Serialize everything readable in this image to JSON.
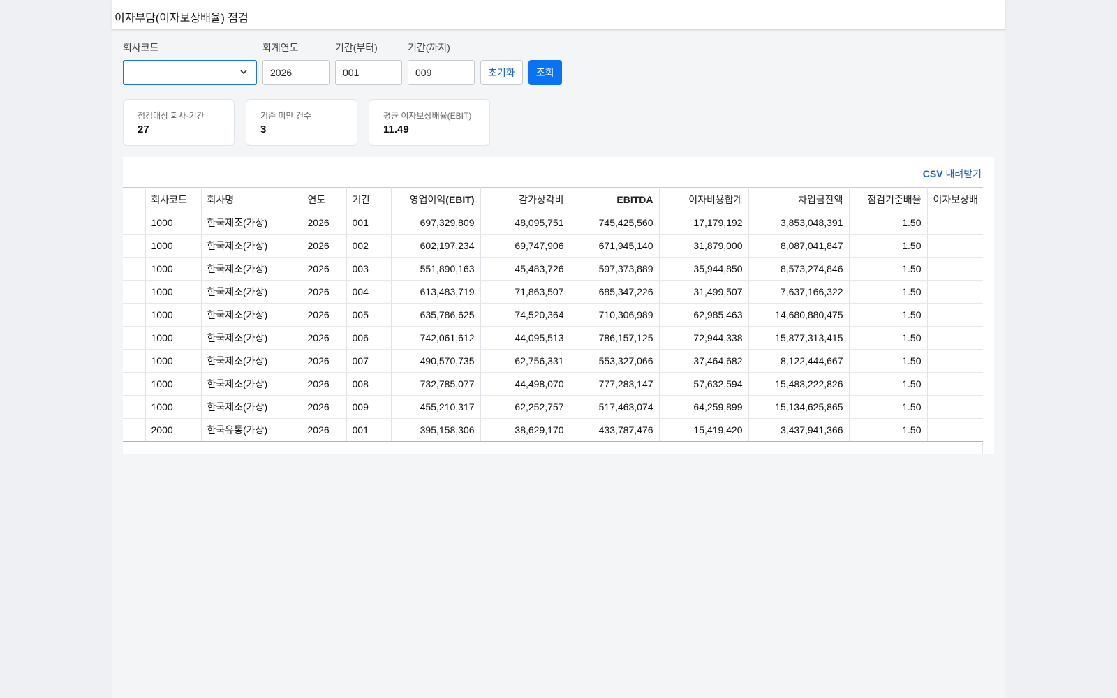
{
  "title": "이자부담(이자보상배율) 점검",
  "filters": {
    "company_label": "회사코드",
    "company_value": "",
    "year_label": "회계연도",
    "year_value": "2026",
    "from_label": "기간(부터)",
    "from_value": "001",
    "to_label": "기간(까지)",
    "to_value": "009",
    "reset_label": "초기화",
    "search_label": "조회"
  },
  "cards": [
    {
      "label": "점검대상 회사-기간",
      "value": "27"
    },
    {
      "label": "기준 미만 건수",
      "value": "3"
    },
    {
      "label": "평균 이자보상배율(EBIT)",
      "value": "11.49"
    }
  ],
  "table": {
    "csv_prefix": "CSV",
    "csv_suffix": " 내려받기",
    "columns": [
      "",
      "회사코드",
      "회사명",
      "연도",
      "기간",
      "영업이익(EBIT)",
      "감가상각비",
      "EBITDA",
      "이자비용합계",
      "차입금잔액",
      "점검기준배율",
      "이자보상배"
    ],
    "rows": [
      [
        "",
        "1000",
        "한국제조(가상)",
        "2026",
        "001",
        "697,329,809",
        "48,095,751",
        "745,425,560",
        "17,179,192",
        "3,853,048,391",
        "1.50",
        ""
      ],
      [
        "",
        "1000",
        "한국제조(가상)",
        "2026",
        "002",
        "602,197,234",
        "69,747,906",
        "671,945,140",
        "31,879,000",
        "8,087,041,847",
        "1.50",
        ""
      ],
      [
        "",
        "1000",
        "한국제조(가상)",
        "2026",
        "003",
        "551,890,163",
        "45,483,726",
        "597,373,889",
        "35,944,850",
        "8,573,274,846",
        "1.50",
        ""
      ],
      [
        "",
        "1000",
        "한국제조(가상)",
        "2026",
        "004",
        "613,483,719",
        "71,863,507",
        "685,347,226",
        "31,499,507",
        "7,637,166,322",
        "1.50",
        ""
      ],
      [
        "",
        "1000",
        "한국제조(가상)",
        "2026",
        "005",
        "635,786,625",
        "74,520,364",
        "710,306,989",
        "62,985,463",
        "14,680,880,475",
        "1.50",
        ""
      ],
      [
        "",
        "1000",
        "한국제조(가상)",
        "2026",
        "006",
        "742,061,612",
        "44,095,513",
        "786,157,125",
        "72,944,338",
        "15,877,313,415",
        "1.50",
        ""
      ],
      [
        "",
        "1000",
        "한국제조(가상)",
        "2026",
        "007",
        "490,570,735",
        "62,756,331",
        "553,327,066",
        "37,464,682",
        "8,122,444,667",
        "1.50",
        ""
      ],
      [
        "",
        "1000",
        "한국제조(가상)",
        "2026",
        "008",
        "732,785,077",
        "44,498,070",
        "777,283,147",
        "57,632,594",
        "15,483,222,826",
        "1.50",
        ""
      ],
      [
        "",
        "1000",
        "한국제조(가상)",
        "2026",
        "009",
        "455,210,317",
        "62,252,757",
        "517,463,074",
        "64,259,899",
        "15,134,625,865",
        "1.50",
        ""
      ],
      [
        "",
        "2000",
        "한국유통(가상)",
        "2026",
        "001",
        "395,158,306",
        "38,629,170",
        "433,787,476",
        "15,419,420",
        "3,437,941,366",
        "1.50",
        ""
      ]
    ]
  }
}
